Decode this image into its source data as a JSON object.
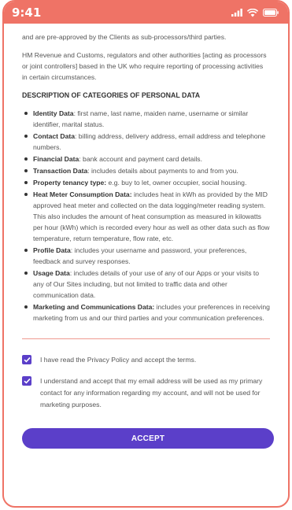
{
  "status_bar": {
    "time": "9:41"
  },
  "intro": {
    "processors_tail": "and are pre-approved by the Clients as sub-processors/third parties.",
    "hmrc": "HM Revenue and Customs, regulators and other authorities [acting as processors or joint controllers] based in the UK who require reporting of processing activities in certain circumstances."
  },
  "section": {
    "heading": "DESCRIPTION OF CATEGORIES OF PERSONAL DATA",
    "items": [
      {
        "term": "Identity Data",
        "text": ": first name, last name, maiden name, username or similar identifier, marital status."
      },
      {
        "term": "Contact Data",
        "text": ": billing address, delivery address, email address and telephone numbers."
      },
      {
        "term": "Financial Data",
        "text": ": bank account and payment card details."
      },
      {
        "term": "Transaction Data",
        "text": ": includes details about payments to and from you."
      },
      {
        "term": "Property tenancy type:",
        "text": " e.g. buy to let, owner occupier, social housing."
      },
      {
        "term": "Heat Meter Consumption Data:",
        "text": " includes heat in kWh as provided by the MID approved heat meter and collected on the data logging/meter reading system. This also includes the amount of heat consumption as measured in kilowatts per hour (kWh) which is recorded every hour as well as other data such as flow temperature, return temperature, flow rate, etc."
      },
      {
        "term": "Profile Data",
        "text": ": includes your username and password, your preferences, feedback and survey responses."
      },
      {
        "term": "Usage Data",
        "text": ": includes details of your use of any of our Apps or your visits to any of Our Sites including, but not limited to traffic data and other communication data."
      },
      {
        "term": "Marketing and Communications Data:",
        "text": " includes your preferences in receiving marketing from us and our third parties and your communication preferences."
      }
    ]
  },
  "consents": {
    "privacy": "I have read the Privacy Policy and accept the terms.",
    "email": "I understand and accept that my email address will be used as my primary contact for any information regarding my account, and will not be used for marketing purposes."
  },
  "accept_button": "ACCEPT",
  "colors": {
    "accent": "#ef7366",
    "primary": "#5b3fc9"
  },
  "icons": [
    "signal-icon",
    "wifi-icon",
    "battery-icon",
    "checkbox-checked-icon"
  ]
}
